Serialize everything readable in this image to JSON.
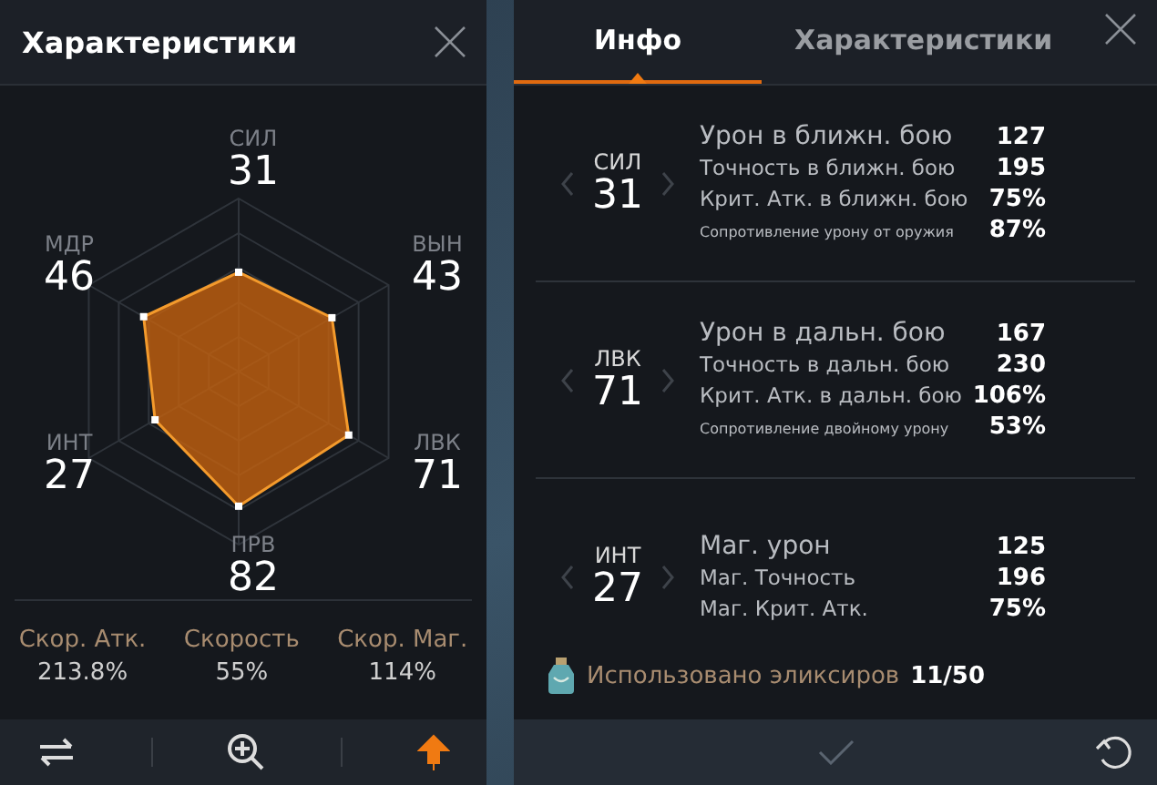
{
  "left_panel": {
    "title": "Характеристики",
    "radar": [
      {
        "label": "СИЛ",
        "value": "31"
      },
      {
        "label": "ВЫН",
        "value": "43"
      },
      {
        "label": "ЛВК",
        "value": "71"
      },
      {
        "label": "ПРВ",
        "value": "82"
      },
      {
        "label": "ИНТ",
        "value": "27"
      },
      {
        "label": "МДР",
        "value": "46"
      }
    ],
    "speed_stats": [
      {
        "label": "Скор. Атк.",
        "value": "213.8%"
      },
      {
        "label": "Скорость",
        "value": "55%"
      },
      {
        "label": "Скор. Маг.",
        "value": "114%"
      }
    ]
  },
  "right_panel": {
    "tabs": [
      {
        "label": "Инфо",
        "selected": true
      },
      {
        "label": "Характеристики",
        "selected": false
      }
    ],
    "sections": [
      {
        "stat": "СИЛ",
        "value": "31",
        "rows": [
          {
            "label": "Урон в ближн. бою",
            "value": "127"
          },
          {
            "label": "Точность в ближн. бою",
            "value": "195"
          },
          {
            "label": "Крит. Атк. в ближн. бою",
            "value": "75%"
          },
          {
            "label": "Сопротивление урону от оружия",
            "value": "87%",
            "small": true
          }
        ]
      },
      {
        "stat": "ЛВК",
        "value": "71",
        "rows": [
          {
            "label": "Урон в дальн. бою",
            "value": "167"
          },
          {
            "label": "Точность в дальн. бою",
            "value": "230"
          },
          {
            "label": "Крит. Атк. в дальн. бою",
            "value": "106%"
          },
          {
            "label": "Сопротивление двойному урону",
            "value": "53%",
            "small": true
          }
        ]
      },
      {
        "stat": "ИНТ",
        "value": "27",
        "rows": [
          {
            "label": "Маг. урон",
            "value": "125"
          },
          {
            "label": "Маг. Точность",
            "value": "196"
          },
          {
            "label": "Маг. Крит. Атк.",
            "value": "75%"
          }
        ]
      }
    ],
    "elixirs": {
      "label": "Использовано эликсиров",
      "value": "11/50"
    }
  }
}
